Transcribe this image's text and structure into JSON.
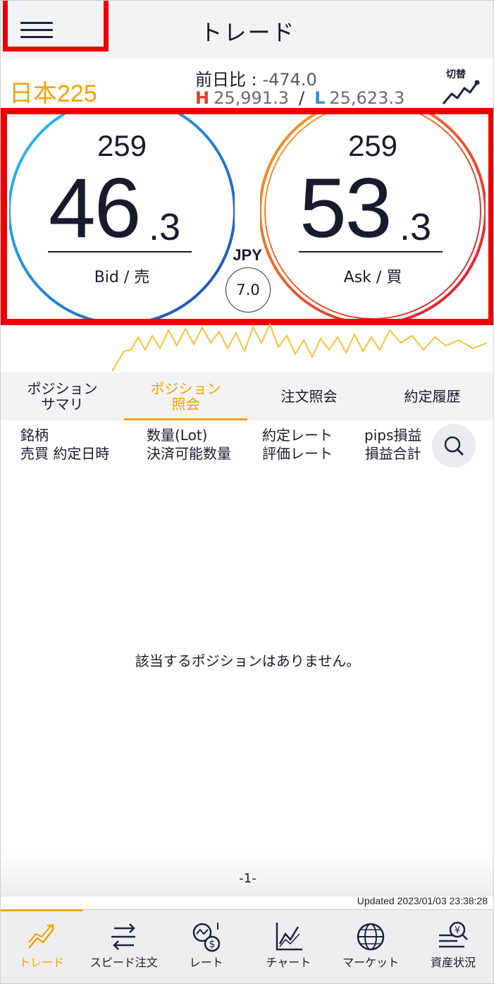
{
  "header": {
    "title": "トレード"
  },
  "symbol": {
    "name": "日本225",
    "change_label": "前日比 : ",
    "change_value": "-474.0",
    "high_letter": "H",
    "high_value": "25,991.3",
    "separator": "/",
    "low_letter": "L",
    "low_value": "25,623.3",
    "switch_label": "切替"
  },
  "quote": {
    "bid": {
      "top": "259",
      "main": "46",
      "decimal": ".3",
      "label": "Bid / 売"
    },
    "ask": {
      "top": "259",
      "main": "53",
      "decimal": ".3",
      "label": "Ask / 買"
    },
    "currency": "JPY",
    "spread": "7.0"
  },
  "tabs": [
    {
      "label": "ポジション\nサマリ"
    },
    {
      "label": "ポジション\n照会"
    },
    {
      "label": "注文照会"
    },
    {
      "label": "約定履歴"
    }
  ],
  "columns": {
    "col1": "銘柄\n売買 約定日時",
    "col2": "数量(Lot)\n決済可能数量",
    "col3": "約定レート\n評価レート",
    "col4": "pips損益\n損益合計"
  },
  "empty_message": "該当するポジションはありません。",
  "page_indicator": "-1-",
  "updated": "Updated  2023/01/03 23:38:28",
  "nav": [
    {
      "label": "トレード",
      "icon": "trade-chart-icon"
    },
    {
      "label": "スピード注文",
      "icon": "speed-order-icon"
    },
    {
      "label": "レート",
      "icon": "rate-icon"
    },
    {
      "label": "チャート",
      "icon": "chart-icon"
    },
    {
      "label": "マーケット",
      "icon": "globe-icon"
    },
    {
      "label": "資産状況",
      "icon": "assets-icon"
    }
  ],
  "colors": {
    "accent": "#f2a300",
    "highlight_box": "#ee0000",
    "bid_ring": "#1e7fe0",
    "ask_ring": "#f07020",
    "high": "#e23b2e",
    "low": "#2d8fe0"
  }
}
